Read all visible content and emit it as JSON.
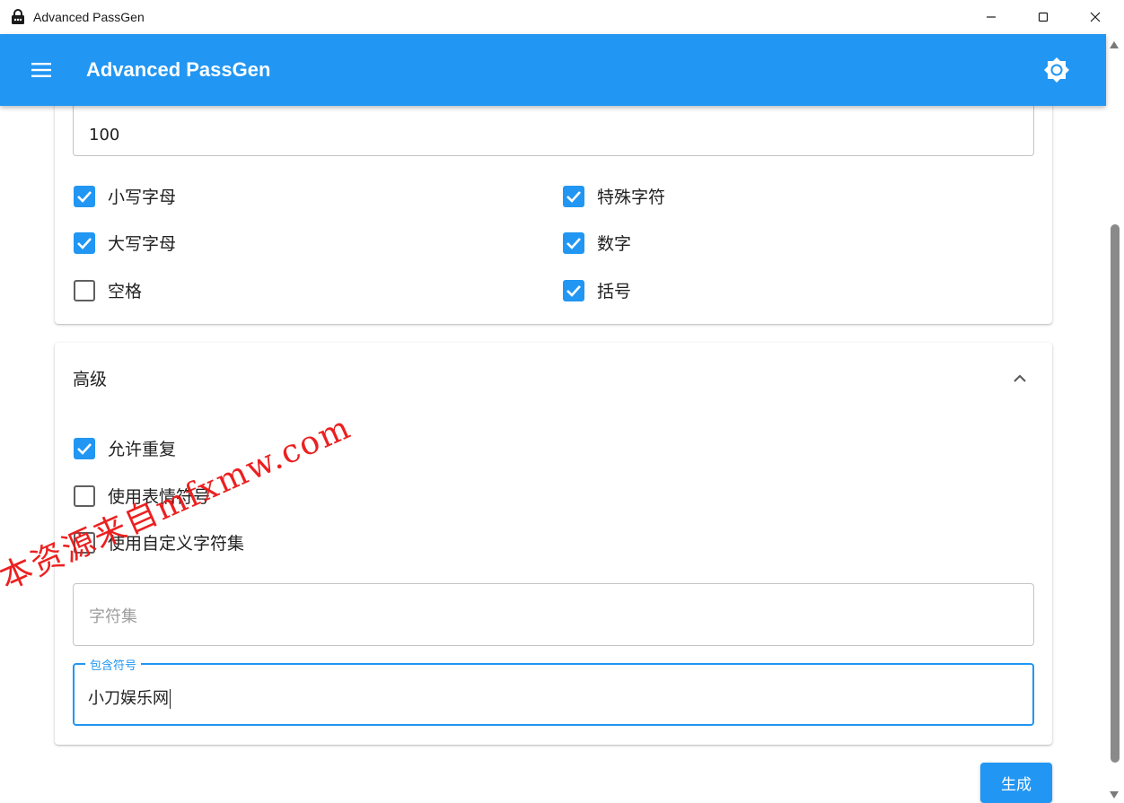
{
  "window": {
    "title": "Advanced PassGen",
    "icon": "lock-icon"
  },
  "appbar": {
    "title": "Advanced PassGen",
    "menu_icon": "menu-icon",
    "theme_icon": "brightness-icon",
    "color": "#2196f3"
  },
  "general": {
    "length_value": "100",
    "options": [
      {
        "label": "小写字母",
        "checked": true
      },
      {
        "label": "特殊字符",
        "checked": true
      },
      {
        "label": "大写字母",
        "checked": true
      },
      {
        "label": "数字",
        "checked": true
      },
      {
        "label": "空格",
        "checked": false
      },
      {
        "label": "括号",
        "checked": true
      }
    ]
  },
  "advanced": {
    "title": "高级",
    "expanded": true,
    "options": [
      {
        "label": "允许重复",
        "checked": true
      },
      {
        "label": "使用表情符号",
        "checked": false
      },
      {
        "label": "使用自定义字符集",
        "checked": false
      }
    ],
    "charset_placeholder": "字符集",
    "include_label": "包含符号",
    "include_value": "小刀娱乐网"
  },
  "generate_label": "生成",
  "watermark": "本资源来自mfxmw.com"
}
